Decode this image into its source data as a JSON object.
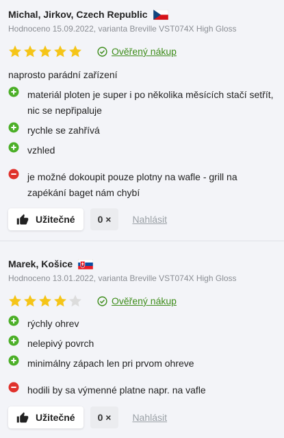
{
  "reviews": [
    {
      "author": "Michal, Jirkov, Czech Republic",
      "flag_icon": "czech-flag-icon",
      "meta": "Hodnoceno 15.09.2022, varianta Breville VST074X High Gloss",
      "stars": 5,
      "verified_label": "Ověřený nákup",
      "summary": "naprosto parádní zařízení",
      "pros": [
        "materiál ploten je super i po několika měsících stačí setřít, nic se nepřipaluje",
        "rychle se zahřívá",
        "vzhled"
      ],
      "cons": [
        "je možné dokoupit pouze plotny na wafle - grill na zapékání baget nám chybí"
      ],
      "helpful_label": "Užitečné",
      "helpful_count": "0 ×",
      "report_label": "Nahlásit"
    },
    {
      "author": "Marek, Košice",
      "flag_icon": "slovak-flag-icon",
      "meta": "Hodnoceno 13.01.2022, varianta Breville VST074X High Gloss",
      "stars": 4,
      "verified_label": "Ověřený nákup",
      "pros": [
        "rýchly ohrev",
        "nelepivý povrch",
        "minimálny zápach len pri prvom ohreve"
      ],
      "cons": [
        "hodili by sa výmenné platne napr. na vafle"
      ],
      "helpful_label": "Užitečné",
      "helpful_count": "0 ×",
      "report_label": "Nahlásit"
    }
  ],
  "colors": {
    "star_filled": "#f5c518",
    "star_empty": "#dcdcdc",
    "verified": "#3d8c1a",
    "pro": "#4caf28",
    "con": "#e0312b"
  }
}
